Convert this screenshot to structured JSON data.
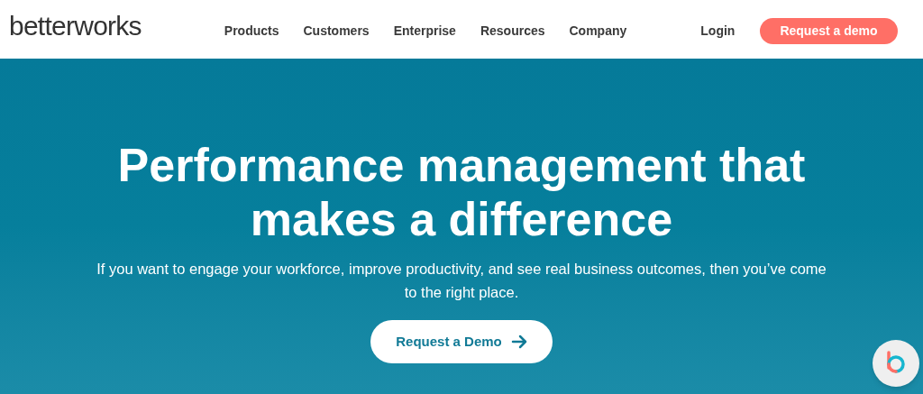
{
  "header": {
    "logo": "betterworks",
    "nav": [
      {
        "label": "Products"
      },
      {
        "label": "Customers"
      },
      {
        "label": "Enterprise"
      },
      {
        "label": "Resources"
      },
      {
        "label": "Company"
      }
    ],
    "login": "Login",
    "cta": "Request a demo"
  },
  "hero": {
    "title": "Performance management that makes a difference",
    "subtitle": "If you want to engage your workforce, improve productivity, and see real business outcomes, then you’ve come to the right place.",
    "button": "Request a Demo"
  }
}
